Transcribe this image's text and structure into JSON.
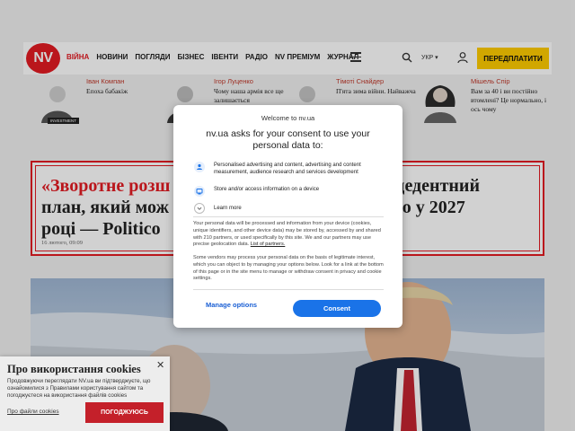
{
  "header": {
    "logo": "NV",
    "nav": [
      "ВІЙНА",
      "НОВИНИ",
      "ПОГЛЯДИ",
      "БІЗНЕС",
      "ІВЕНТИ",
      "РАДІО",
      "NV ПРЕМІУМ",
      "ЖУРНАЛ"
    ],
    "lang": "УКР",
    "subscribe": "ПЕРЕДПЛАТИТИ"
  },
  "columnists": [
    {
      "name": "Іван Компан",
      "title": "Епоха бабакіж",
      "badge": "INVESTMENT"
    },
    {
      "name": "Ігор Луценко",
      "title": "Чому наша армія все ще залишається"
    },
    {
      "name": "Тімоті Снайдер",
      "title": "П'ята зима війни. Найважча"
    },
    {
      "name": "Мішель Спір",
      "title": "Вам за 40 і ви постійно втомлені? Це нормально, і ось чому"
    }
  ],
  "headline": {
    "line1_red": "«Зворотне розш",
    "line1_rest": "зпрецедентний",
    "line2_start": "план, який мож",
    "line2_rest": "енство у 2027",
    "line3": "році — Politico",
    "date": "16 лютого, 09:09"
  },
  "consent": {
    "site": "Welcome to nv.ua",
    "heading": "nv.ua asks for your consent to use your personal data to:",
    "purposes": [
      "Personalised advertising and content, advertising and content measurement, audience research and services development",
      "Store and/or access information on a device"
    ],
    "learn_more": "Learn more",
    "body1": "Your personal data will be processed and information from your device (cookies, unique identifiers, and other device data) may be stored by, accessed by and shared with 210 partners, or used specifically by this site. We and our partners may use precise geolocation data.",
    "list_link": "List of partners.",
    "body2": "Some vendors may process your personal data on the basis of legitimate interest, which you can object to by managing your options below. Look for a link at the bottom of this page or in the site menu to manage or withdraw consent in privacy and cookie settings.",
    "manage": "Manage options",
    "consent_btn": "Consent"
  },
  "cookie": {
    "title": "Про використання cookies",
    "close": "✕",
    "text": "Продовжуючи переглядати NV.ua ви підтверджуєте, що ознайомилися з Правилами користування сайтом та погоджуєтеся на використання файлів cookies",
    "link": "Про файли cookies",
    "button": "ПОГОДЖУЮСЬ"
  },
  "colors": {
    "brand": "#e31b23",
    "accent": "#ffcc00",
    "consent_blue": "#1a73e8"
  }
}
